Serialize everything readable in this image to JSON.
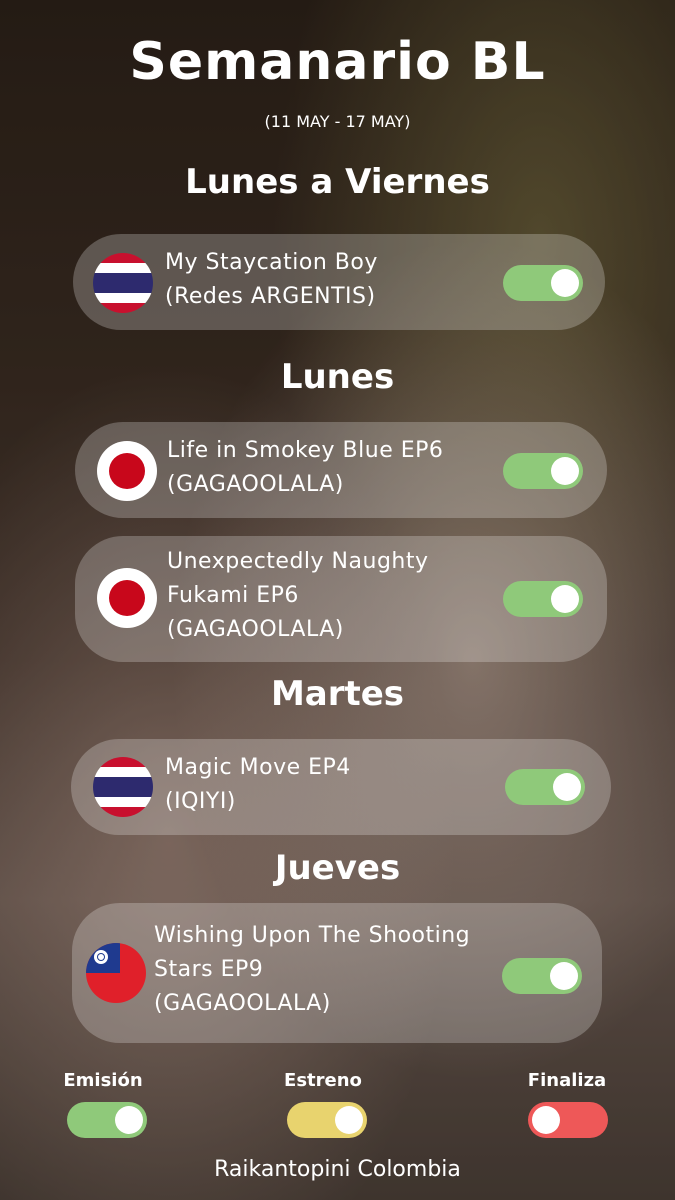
{
  "header": {
    "title": "Semanario BL",
    "dates": "(11 MAY - 17 MAY)"
  },
  "sections": [
    {
      "heading": "Lunes a Viernes",
      "items": [
        {
          "flag": "thailand-flag-icon",
          "lines": [
            "My Staycation Boy",
            "(Redes ARGENTIS)"
          ],
          "status": "emision"
        }
      ]
    },
    {
      "heading": "Lunes",
      "items": [
        {
          "flag": "japan-flag-icon",
          "lines": [
            "Life in Smokey Blue EP6",
            "(GAGAOOLALA)"
          ],
          "status": "emision"
        },
        {
          "flag": "japan-flag-icon",
          "lines": [
            "Unexpectedly Naughty",
            "Fukami EP6",
            "(GAGAOOLALA)"
          ],
          "status": "emision"
        }
      ]
    },
    {
      "heading": "Martes",
      "items": [
        {
          "flag": "thailand-flag-icon",
          "lines": [
            "Magic Move EP4",
            "(IQIYI)"
          ],
          "status": "emision"
        }
      ]
    },
    {
      "heading": "Jueves",
      "items": [
        {
          "flag": "taiwan-flag-icon",
          "lines": [
            "Wishing Upon The Shooting",
            "Stars EP9",
            "(GAGAOOLALA)"
          ],
          "status": "emision"
        }
      ]
    }
  ],
  "legend": [
    {
      "label": "Emisión",
      "color": "#8fc97a",
      "knob": "right"
    },
    {
      "label": "Estreno",
      "color": "#e8d36e",
      "knob": "right"
    },
    {
      "label": "Finaliza",
      "color": "#ee5858",
      "knob": "left"
    }
  ],
  "footer": "Raikantopini Colombia"
}
